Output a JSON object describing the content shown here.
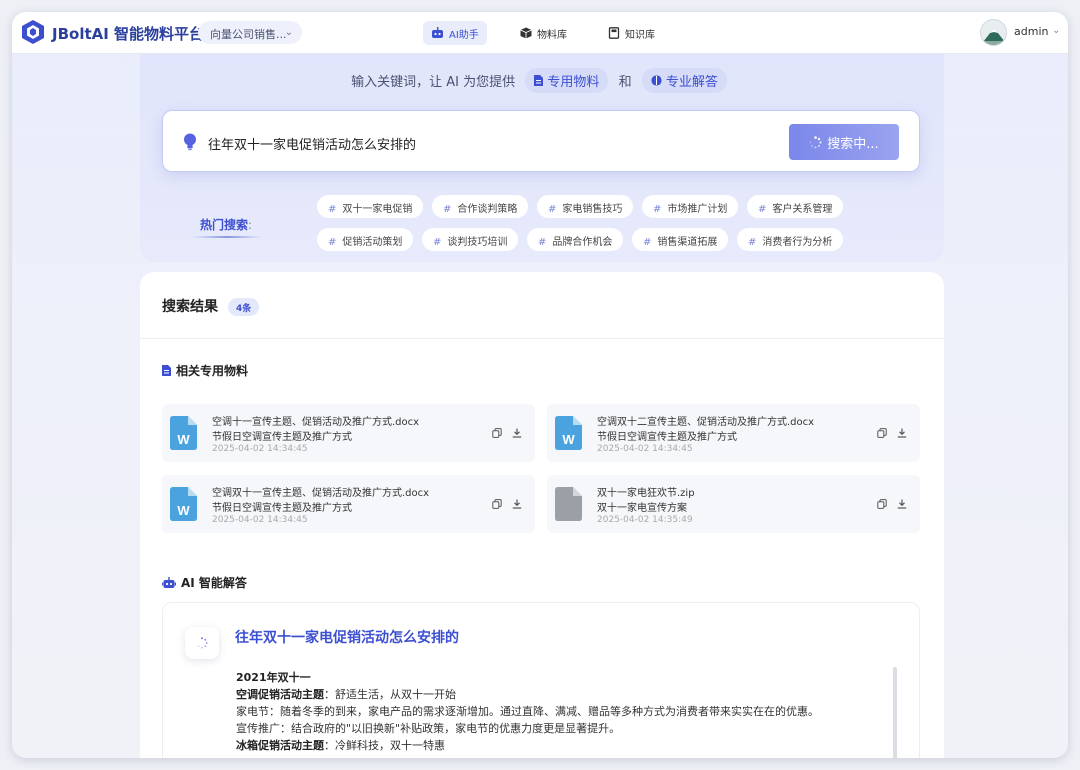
{
  "header": {
    "brand": "JBoltAI 智能物料平台",
    "company": "向量公司销售...",
    "nav": [
      {
        "label": "AI助手"
      },
      {
        "label": "物料库"
      },
      {
        "label": "知识库"
      }
    ],
    "user": "admin"
  },
  "search": {
    "tagline_pre": "输入关键词，让 AI 为您提供",
    "pill_materials": "专用物料",
    "tagline_and": "和",
    "pill_answers": "专业解答",
    "query": "往年双十一家电促销活动怎么安排的",
    "button_label": "搜索中..."
  },
  "hot": {
    "label": "热门搜索",
    "colon": ":",
    "tags": [
      "双十一家电促销",
      "合作谈判策略",
      "家电销售技巧",
      "市场推广计划",
      "客户关系管理",
      "促销活动策划",
      "谈判技巧培训",
      "品牌合作机会",
      "销售渠道拓展",
      "消费者行为分析"
    ]
  },
  "results": {
    "title": "搜索结果",
    "count": "4条",
    "materials_heading": "相关专用物料",
    "files": [
      {
        "type": "word",
        "name": "空调十一宣传主题、促销活动及推广方式.docx",
        "desc": "节假日空调宣传主题及推广方式",
        "time": "2025-04-02 14:34:45"
      },
      {
        "type": "word",
        "name": "空调双十二宣传主题、促销活动及推广方式.docx",
        "desc": "节假日空调宣传主题及推广方式",
        "time": "2025-04-02 14:34:45"
      },
      {
        "type": "word",
        "name": "空调双十一宣传主题、促销活动及推广方式.docx",
        "desc": "节假日空调宣传主题及推广方式",
        "time": "2025-04-02 14:34:45"
      },
      {
        "type": "zip",
        "name": "双十一家电狂欢节.zip",
        "desc": "双十一家电宣传方案",
        "time": "2025-04-02 14:35:49"
      }
    ],
    "ai_heading": "AI 智能解答",
    "answer": {
      "title": "往年双十一家电促销活动怎么安排的",
      "year": "2021年双十一",
      "ac_label": "空调促销活动主题",
      "ac_value": "：舒适生活，从双十一开始",
      "line1": "家电节：随着冬季的到来，家电产品的需求逐渐增加。通过直降、满减、赠品等多种方式为消费者带来实实在在的优惠。",
      "line2": "宣传推广：结合政府的\"以旧换新\"补贴政策，家电节的优惠力度更是显著提升。",
      "fridge_label": "冰箱促销活动主题",
      "fridge_value": "：冷鲜科技，双十一特惠"
    }
  },
  "colors": {
    "accent": "#3d4fd1",
    "word": "#4aa3df",
    "zip": "#9aa0a6"
  }
}
